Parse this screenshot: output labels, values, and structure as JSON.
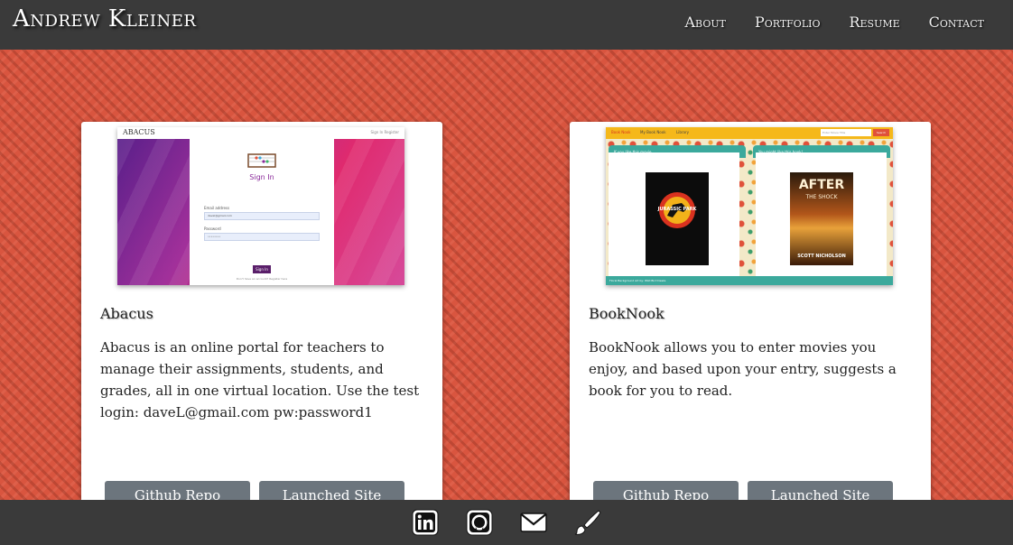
{
  "header": {
    "brand": "Andrew Kleiner",
    "nav": [
      "About",
      "Portfolio",
      "Resume",
      "Contact"
    ]
  },
  "projects": [
    {
      "title": "Abacus",
      "description": "Abacus is an online portal for teachers to manage their assignments, students, and grades, all in one virtual location. Use the test login: daveL@gmail.com pw:password1",
      "buttons": [
        "Github Repo",
        "Launched Site"
      ],
      "thumbnail": {
        "logo": "ABACUS",
        "links": "Sign In   Register",
        "heading": "Sign In",
        "email_label": "Email address",
        "email_value": "davel@gmail.com",
        "password_label": "Password",
        "password_value": "••••••••",
        "button": "Sign In",
        "footer": "Don't have an account? Register here"
      }
    },
    {
      "title": "BookNook",
      "description": "BookNook allows you to enter movies you enjoy, and based upon your entry, suggests a book for you to read.",
      "buttons": [
        "Github Repo",
        "Launched Site"
      ],
      "thumbnail": {
        "nav": [
          "Book Nook",
          "My Book Nook",
          "Library"
        ],
        "search_placeholder": "Enter Movie Title",
        "search_button": "Search",
        "left_heading": "If you like this movie...",
        "right_heading": "You might like this book!",
        "movie_title": "JURASSIC PARK",
        "book_title_1": "AFTER",
        "book_title_2": "THE SHOCK",
        "book_author": "SCOTT NICHOLSON",
        "footer": "Floral Background Art by: Wild Bird Desks"
      }
    }
  ],
  "footer": {
    "icons": [
      "linkedin-icon",
      "github-icon",
      "email-icon",
      "paintbrush-icon"
    ]
  },
  "colors": {
    "navbar": "#3a3a3a",
    "background": "#d9553f",
    "button": "#6c757d",
    "card": "#ffffff"
  }
}
